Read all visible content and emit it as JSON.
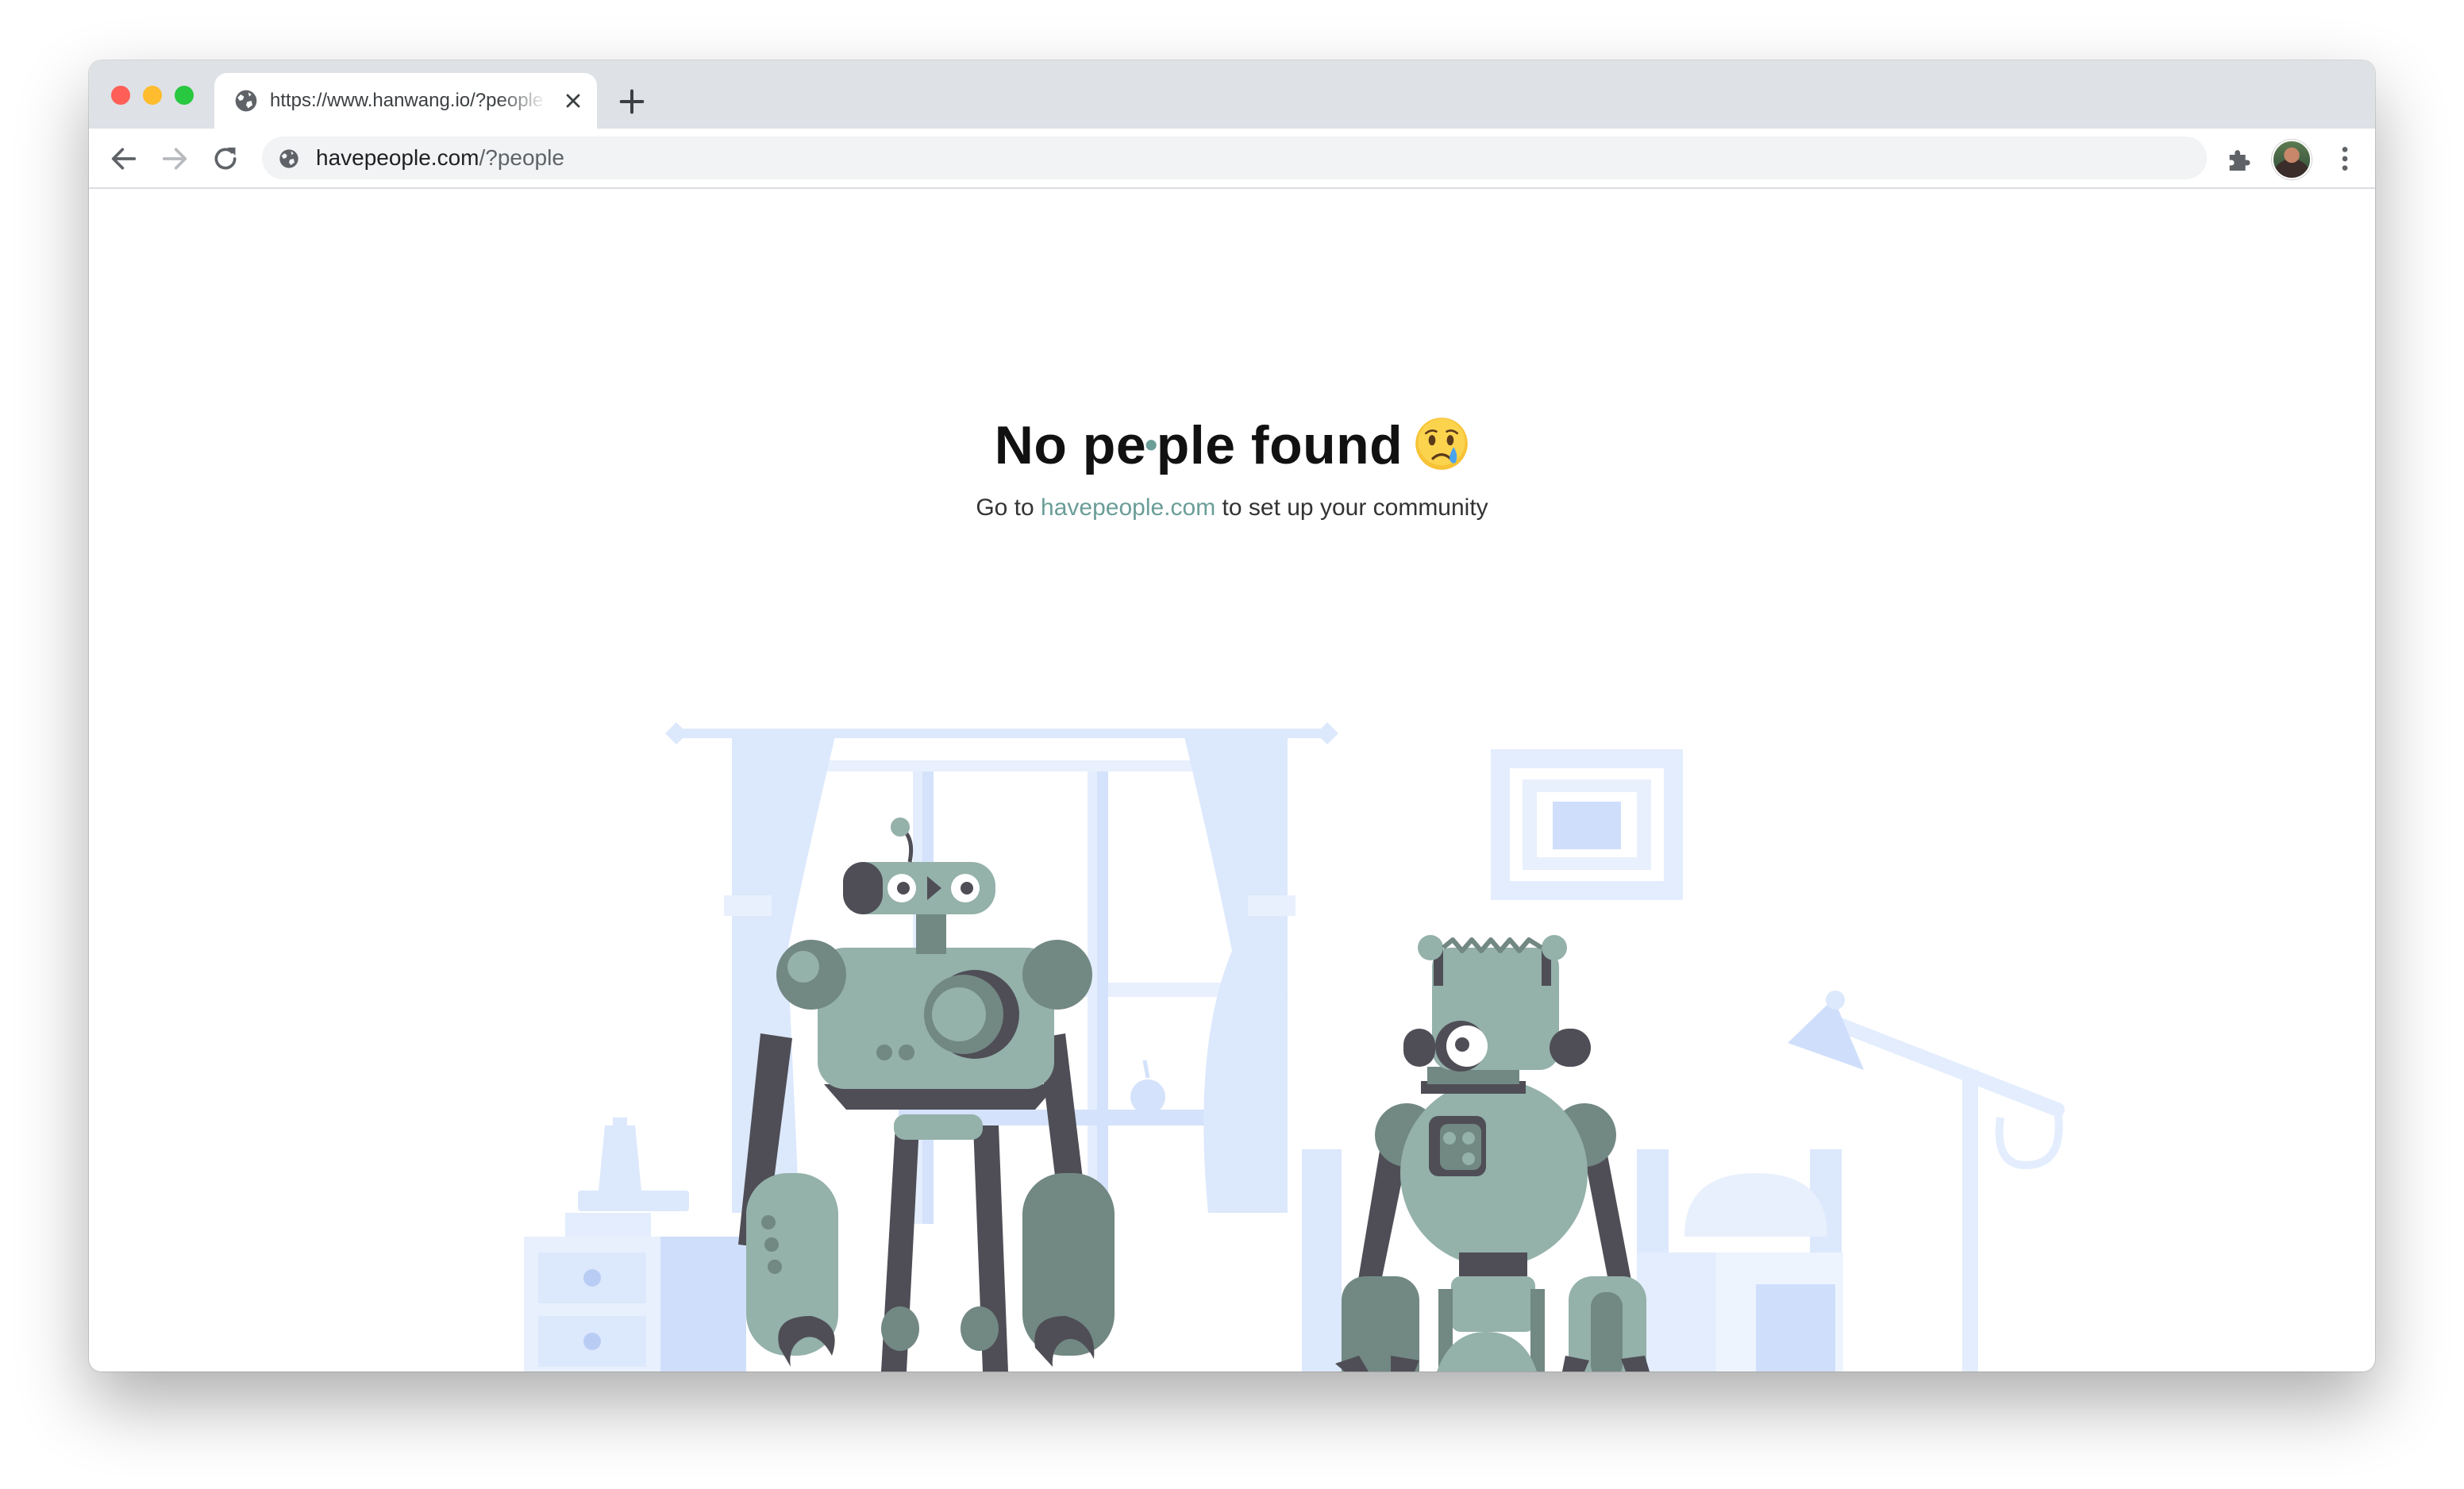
{
  "browser": {
    "tab_title": "https://www.hanwang.io/?people",
    "url_host": "havepeople.com",
    "url_path": "/?people"
  },
  "page": {
    "heading_before": "No pe",
    "heading_dot": "•",
    "heading_after": "ple found",
    "emoji_name": "crying-face-emoji",
    "subtitle_prefix": "Go to",
    "subtitle_link": "havepeople.com",
    "subtitle_suffix": "to set up your community",
    "link_color": "#6a9d98"
  },
  "icons": {
    "tab_favicon": "globe-icon",
    "tab_close": "close-icon",
    "new_tab": "plus-icon",
    "back": "arrow-left-icon",
    "forward": "arrow-right-icon",
    "reload": "reload-icon",
    "site_info": "globe-icon",
    "extensions": "puzzle-icon",
    "profile": "avatar",
    "menu": "kebab-menu-icon"
  },
  "colors": {
    "robot_body": "#94b1aa",
    "robot_dark": "#4f4e56",
    "robot_mid": "#728883",
    "room": "#dce8fc"
  }
}
